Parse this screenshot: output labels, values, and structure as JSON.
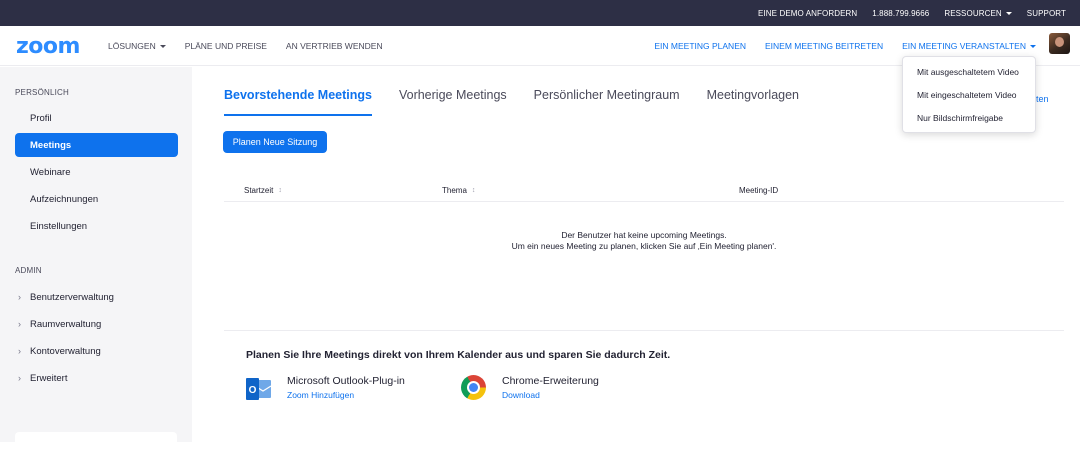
{
  "topbar": {
    "demo": "EINE DEMO ANFORDERN",
    "phone": "1.888.799.9666",
    "resources": "RESSOURCEN",
    "support": "SUPPORT"
  },
  "header": {
    "logo": "zoom",
    "nav_left": [
      "LÖSUNGEN",
      "PLÄNE UND PREISE",
      "AN VERTRIEB WENDEN"
    ],
    "schedule": "EIN MEETING PLANEN",
    "join": "EINEM MEETING BEITRETEN",
    "host": "EIN MEETING VERANSTALTEN"
  },
  "sidebar": {
    "personal_label": "PERSÖNLICH",
    "personal_items": [
      "Profil",
      "Meetings",
      "Webinare",
      "Aufzeichnungen",
      "Einstellungen"
    ],
    "admin_label": "ADMIN",
    "admin_items": [
      "Benutzerverwaltung",
      "Raumverwaltung",
      "Kontoverwaltung",
      "Erweitert"
    ]
  },
  "tabs": [
    "Bevorstehende Meetings",
    "Vorherige Meetings",
    "Persönlicher Meetingraum",
    "Meetingvorlagen"
  ],
  "partial_link": "ten",
  "schedule_button": "Planen Neue Sitzung",
  "table": {
    "col_start": "Startzeit",
    "col_topic": "Thema",
    "col_id": "Meeting-ID"
  },
  "empty": {
    "line1": "Der Benutzer hat keine upcoming Meetings.",
    "line2": "Um ein neues Meeting zu planen, klicken Sie auf ‚Ein Meeting planen'."
  },
  "calendar": {
    "title": "Planen Sie Ihre Meetings direkt von Ihrem Kalender aus und sparen Sie dadurch Zeit.",
    "outlook_name": "Microsoft Outlook-Plug-in",
    "outlook_link": "Zoom Hinzufügen",
    "chrome_name": "Chrome-Erweiterung",
    "chrome_link": "Download"
  },
  "dropdown": {
    "items": [
      "Mit ausgeschaltetem Video",
      "Mit eingeschaltetem Video",
      "Nur Bildschirmfreigabe"
    ]
  }
}
